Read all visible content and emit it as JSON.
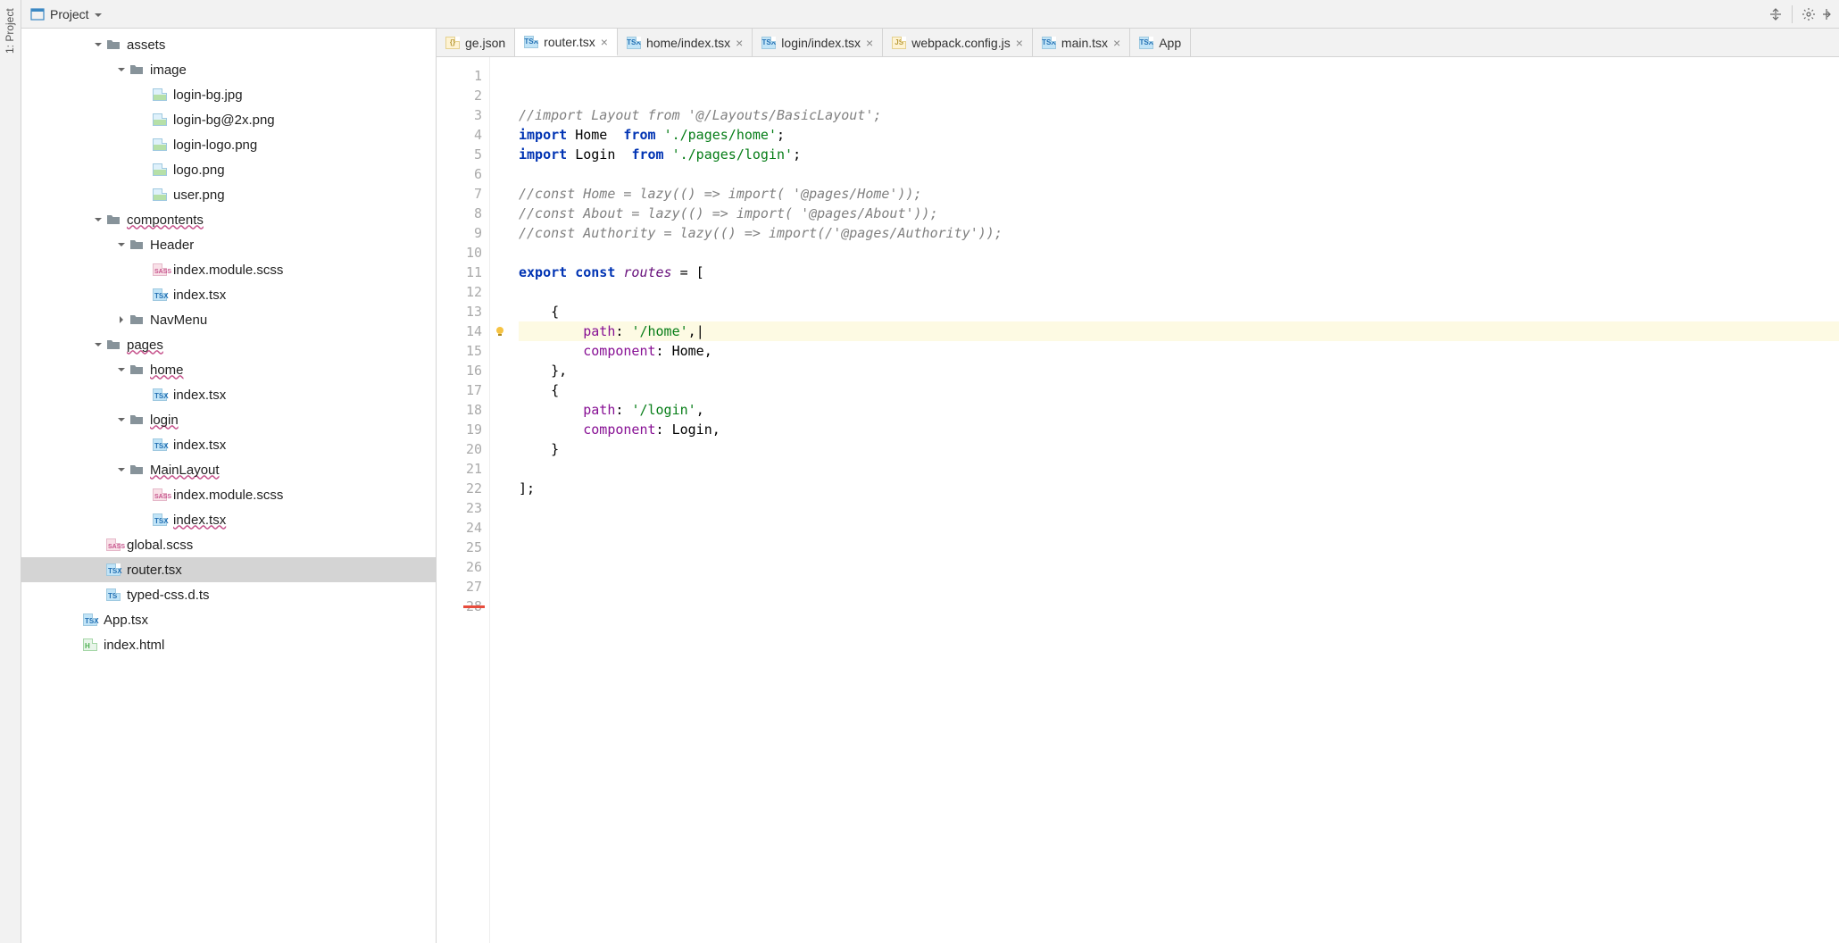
{
  "leftBar": {
    "label": "1: Project"
  },
  "toolbar": {
    "project_label": "Project"
  },
  "tabs": [
    {
      "name": "ge.json",
      "icon": "json",
      "active": false,
      "partial": true
    },
    {
      "name": "router.tsx",
      "icon": "tsx",
      "active": true
    },
    {
      "name": "home/index.tsx",
      "icon": "tsx",
      "active": false
    },
    {
      "name": "login/index.tsx",
      "icon": "tsx",
      "active": false
    },
    {
      "name": "webpack.config.js",
      "icon": "js",
      "active": false
    },
    {
      "name": "main.tsx",
      "icon": "tsx",
      "active": false
    },
    {
      "name": "App",
      "icon": "tsx",
      "active": false,
      "partial": true
    }
  ],
  "tree": [
    {
      "level": 2,
      "toggle": "down",
      "icon": "folder",
      "label": "assets",
      "selected": false
    },
    {
      "level": 3,
      "toggle": "down",
      "icon": "folder",
      "label": "image",
      "selected": false
    },
    {
      "level": 4,
      "toggle": "none",
      "icon": "img",
      "label": "login-bg.jpg",
      "selected": false
    },
    {
      "level": 4,
      "toggle": "none",
      "icon": "img",
      "label": "login-bg@2x.png",
      "selected": false
    },
    {
      "level": 4,
      "toggle": "none",
      "icon": "img",
      "label": "login-logo.png",
      "selected": false
    },
    {
      "level": 4,
      "toggle": "none",
      "icon": "img",
      "label": "logo.png",
      "selected": false
    },
    {
      "level": 4,
      "toggle": "none",
      "icon": "img",
      "label": "user.png",
      "selected": false
    },
    {
      "level": 2,
      "toggle": "down",
      "icon": "folder",
      "label": "compontents",
      "selected": false,
      "wavy": true
    },
    {
      "level": 3,
      "toggle": "down",
      "icon": "folder",
      "label": "Header",
      "selected": false
    },
    {
      "level": 4,
      "toggle": "none",
      "icon": "sass",
      "label": "index.module.scss",
      "selected": false
    },
    {
      "level": 4,
      "toggle": "none",
      "icon": "tsx",
      "label": "index.tsx",
      "selected": false
    },
    {
      "level": 3,
      "toggle": "right",
      "icon": "folder",
      "label": "NavMenu",
      "selected": false
    },
    {
      "level": 2,
      "toggle": "down",
      "icon": "folder",
      "label": "pages",
      "selected": false,
      "wavy": true
    },
    {
      "level": 3,
      "toggle": "down",
      "icon": "folder",
      "label": "home",
      "selected": false,
      "wavy": true
    },
    {
      "level": 4,
      "toggle": "none",
      "icon": "tsx",
      "label": "index.tsx",
      "selected": false
    },
    {
      "level": 3,
      "toggle": "down",
      "icon": "folder",
      "label": "login",
      "selected": false,
      "wavy": true
    },
    {
      "level": 4,
      "toggle": "none",
      "icon": "tsx",
      "label": "index.tsx",
      "selected": false
    },
    {
      "level": 3,
      "toggle": "down",
      "icon": "folder",
      "label": "MainLayout",
      "selected": false,
      "wavy": true
    },
    {
      "level": 4,
      "toggle": "none",
      "icon": "sass",
      "label": "index.module.scss",
      "selected": false
    },
    {
      "level": 4,
      "toggle": "none",
      "icon": "tsx",
      "label": "index.tsx",
      "selected": false,
      "wavy": true
    },
    {
      "level": 2,
      "toggle": "none",
      "icon": "sass",
      "label": "global.scss",
      "selected": false
    },
    {
      "level": 2,
      "toggle": "none",
      "icon": "tsx",
      "label": "router.tsx",
      "selected": true
    },
    {
      "level": 2,
      "toggle": "none",
      "icon": "ts",
      "label": "typed-css.d.ts",
      "selected": false
    },
    {
      "level": 1,
      "toggle": "none",
      "icon": "tsx",
      "label": "App.tsx",
      "selected": false
    },
    {
      "level": 1,
      "toggle": "none",
      "icon": "html",
      "label": "index.html",
      "selected": false
    }
  ],
  "editor": {
    "lineStart": 1,
    "lineCount": 28,
    "highlightLine": 14,
    "bulbLine": 14,
    "redMarkLine": 28,
    "lines": [
      {
        "tokens": []
      },
      {
        "tokens": []
      },
      {
        "tokens": [
          {
            "t": "//import Layout from '@/Layouts/BasicLayout';",
            "c": "comment"
          }
        ]
      },
      {
        "tokens": [
          {
            "t": "import",
            "c": "keyword"
          },
          {
            "t": " Home  ",
            "c": "ident"
          },
          {
            "t": "from",
            "c": "keyword"
          },
          {
            "t": " ",
            "c": ""
          },
          {
            "t": "'./pages/home'",
            "c": "path"
          },
          {
            "t": ";",
            "c": "punc"
          }
        ]
      },
      {
        "tokens": [
          {
            "t": "import",
            "c": "keyword"
          },
          {
            "t": " Login  ",
            "c": "ident"
          },
          {
            "t": "from",
            "c": "keyword"
          },
          {
            "t": " ",
            "c": ""
          },
          {
            "t": "'./pages/login'",
            "c": "path"
          },
          {
            "t": ";",
            "c": "punc"
          }
        ]
      },
      {
        "tokens": []
      },
      {
        "tokens": [
          {
            "t": "//const Home = lazy(() => import( '@pages/Home'));",
            "c": "comment"
          }
        ]
      },
      {
        "tokens": [
          {
            "t": "//const About = lazy(() => import( '@pages/About'));",
            "c": "comment"
          }
        ]
      },
      {
        "tokens": [
          {
            "t": "//const Authority = lazy(() => import(/'@pages/Authority'));",
            "c": "comment"
          }
        ]
      },
      {
        "tokens": []
      },
      {
        "tokens": [
          {
            "t": "export const",
            "c": "keyword"
          },
          {
            "t": " ",
            "c": ""
          },
          {
            "t": "routes",
            "c": "var"
          },
          {
            "t": " = [",
            "c": "punc"
          }
        ]
      },
      {
        "tokens": []
      },
      {
        "tokens": [
          {
            "t": "    {",
            "c": "punc"
          }
        ]
      },
      {
        "tokens": [
          {
            "t": "        ",
            "c": ""
          },
          {
            "t": "path",
            "c": "prop"
          },
          {
            "t": ": ",
            "c": "punc"
          },
          {
            "t": "'/home'",
            "c": "path"
          },
          {
            "t": ",",
            "c": "punc"
          }
        ],
        "cursor": true
      },
      {
        "tokens": [
          {
            "t": "        ",
            "c": ""
          },
          {
            "t": "component",
            "c": "prop"
          },
          {
            "t": ": Home,",
            "c": "punc"
          }
        ]
      },
      {
        "tokens": [
          {
            "t": "    },",
            "c": "punc"
          }
        ]
      },
      {
        "tokens": [
          {
            "t": "    {",
            "c": "punc"
          }
        ]
      },
      {
        "tokens": [
          {
            "t": "        ",
            "c": ""
          },
          {
            "t": "path",
            "c": "prop"
          },
          {
            "t": ": ",
            "c": "punc"
          },
          {
            "t": "'/login'",
            "c": "path"
          },
          {
            "t": ",",
            "c": "punc"
          }
        ]
      },
      {
        "tokens": [
          {
            "t": "        ",
            "c": ""
          },
          {
            "t": "component",
            "c": "prop"
          },
          {
            "t": ": Login,",
            "c": "punc"
          }
        ]
      },
      {
        "tokens": [
          {
            "t": "    }",
            "c": "punc"
          }
        ]
      },
      {
        "tokens": []
      },
      {
        "tokens": [
          {
            "t": "];",
            "c": "punc"
          }
        ]
      },
      {
        "tokens": []
      },
      {
        "tokens": []
      },
      {
        "tokens": []
      },
      {
        "tokens": []
      },
      {
        "tokens": []
      },
      {
        "tokens": []
      }
    ]
  }
}
